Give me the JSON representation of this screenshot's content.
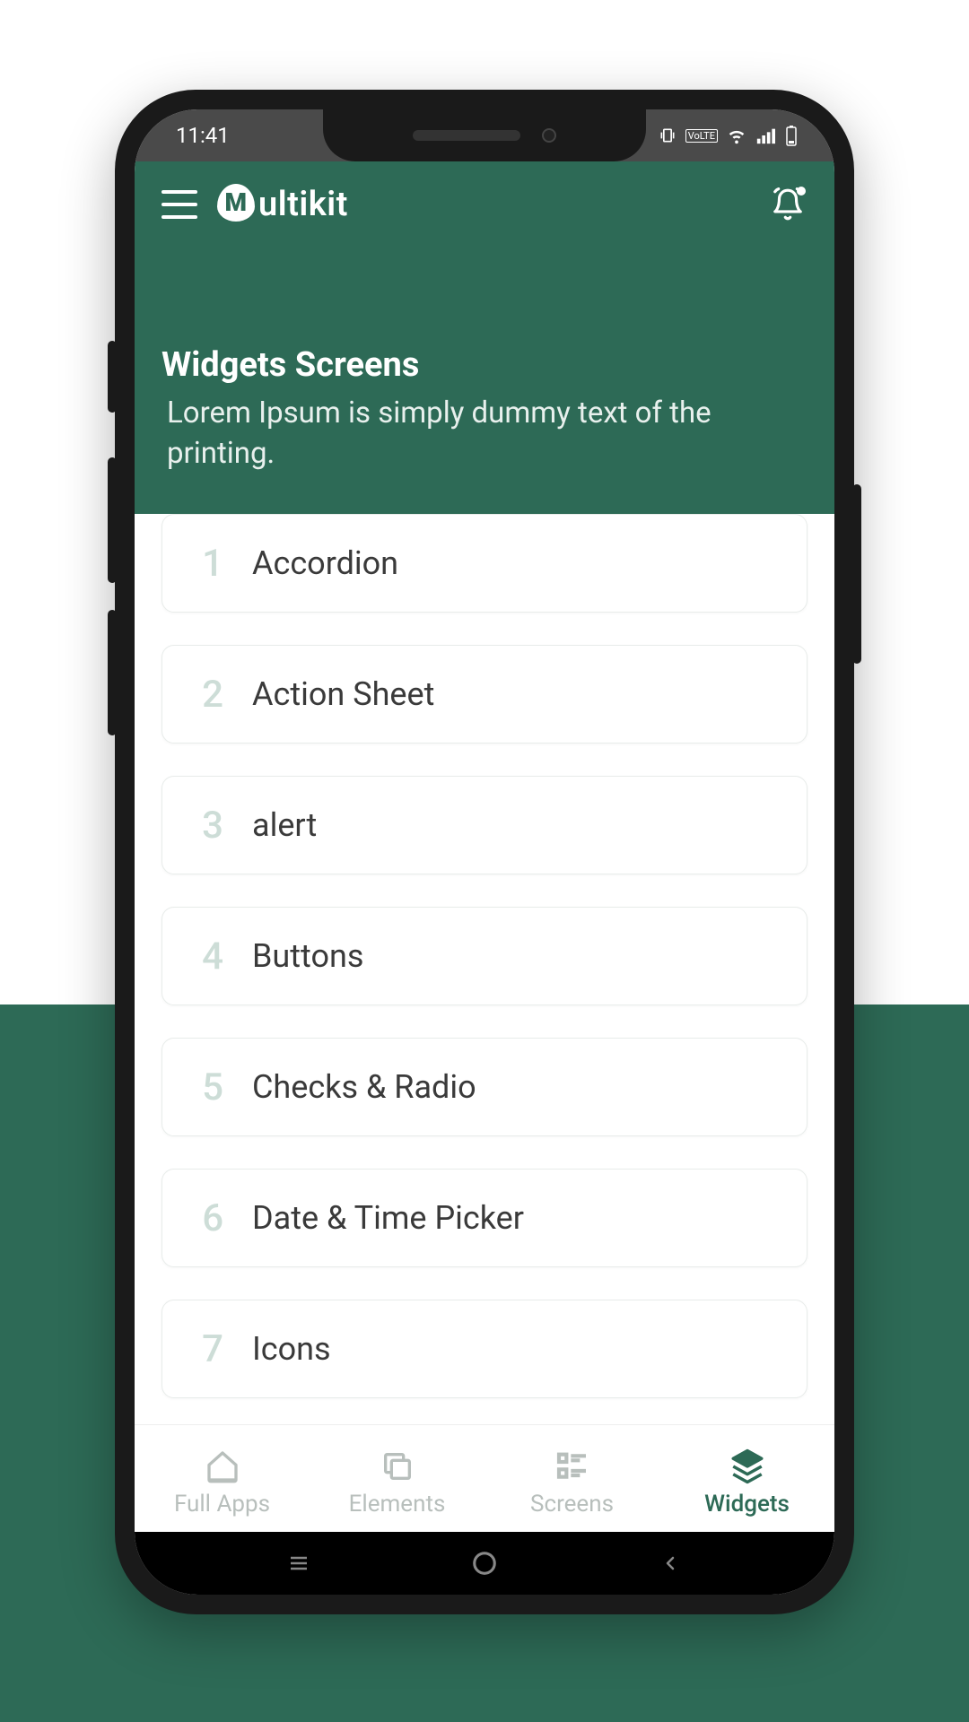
{
  "status": {
    "time": "11:41"
  },
  "logo": {
    "m": "M",
    "rest": "ultikit"
  },
  "header": {
    "title": "Widgets Screens",
    "subtitle": " Lorem Ipsum is simply dummy text of the printing."
  },
  "list": [
    {
      "num": "1",
      "label": "Accordion"
    },
    {
      "num": "2",
      "label": "Action Sheet"
    },
    {
      "num": "3",
      "label": "alert"
    },
    {
      "num": "4",
      "label": "Buttons"
    },
    {
      "num": "5",
      "label": "Checks & Radio"
    },
    {
      "num": "6",
      "label": "Date & Time Picker"
    },
    {
      "num": "7",
      "label": "Icons"
    }
  ],
  "nav": {
    "items": [
      {
        "label": "Full Apps"
      },
      {
        "label": "Elements"
      },
      {
        "label": "Screens"
      },
      {
        "label": "Widgets"
      }
    ]
  }
}
